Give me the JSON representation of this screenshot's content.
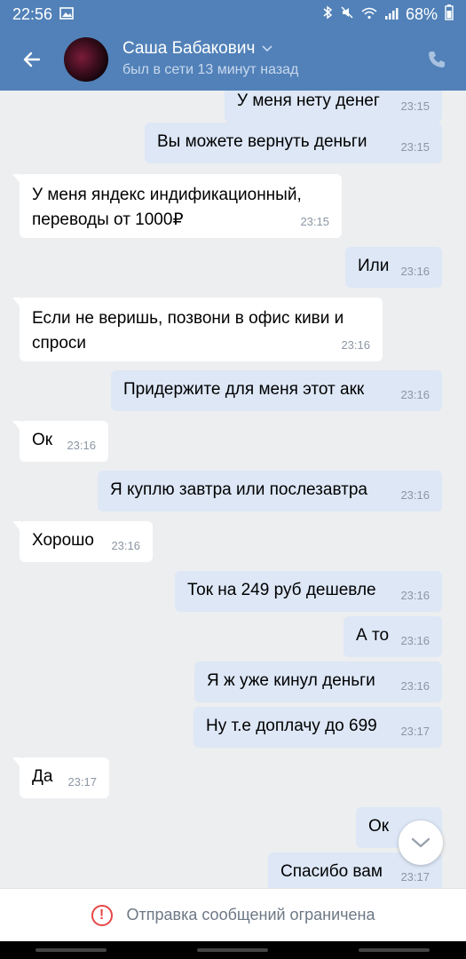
{
  "status_bar": {
    "time": "22:56",
    "icons": [
      "image-icon",
      "bluetooth-icon",
      "mute-icon",
      "wifi-icon",
      "signal-icon"
    ],
    "battery": "68%"
  },
  "header": {
    "contact_name": "Саша Бабакович",
    "status": "был в сети 13 минут назад"
  },
  "messages": [
    {
      "dir": "out",
      "text": "У меня нету денег",
      "time": "23:15"
    },
    {
      "dir": "out",
      "text": "Вы можете вернуть деньги",
      "time": "23:15"
    },
    {
      "dir": "in",
      "text": "У меня яндекс индификационный, переводы от 1000₽",
      "time": "23:15"
    },
    {
      "dir": "out",
      "text": "Или",
      "time": "23:16"
    },
    {
      "dir": "in",
      "text": "Если не веришь, позвони в офис киви и спроси",
      "time": "23:16"
    },
    {
      "dir": "out",
      "text": "Придержите для меня этот акк",
      "time": "23:16"
    },
    {
      "dir": "in",
      "text": "Ок",
      "time": "23:16"
    },
    {
      "dir": "out",
      "text": "Я куплю завтра или послезавтра",
      "time": "23:16"
    },
    {
      "dir": "in",
      "text": "Хорошо",
      "time": "23:16"
    },
    {
      "dir": "out",
      "text": "Ток на 249 руб дешевле",
      "time": "23:16"
    },
    {
      "dir": "out",
      "text": "А то",
      "time": "23:16"
    },
    {
      "dir": "out",
      "text": "Я ж уже кинул деньги",
      "time": "23:16"
    },
    {
      "dir": "out",
      "text": "Ну т.е доплачу до 699",
      "time": "23:17"
    },
    {
      "dir": "in",
      "text": "Да",
      "time": "23:17"
    },
    {
      "dir": "out",
      "text": "Ок",
      "time": ""
    },
    {
      "dir": "out",
      "text": "Спасибо вам",
      "time": "23:17"
    }
  ],
  "footer": {
    "restriction_text": "Отправка сообщений ограничена"
  },
  "colors": {
    "header": "#5181b8",
    "outgoing_bubble": "#dde7f6",
    "incoming_bubble": "#ffffff",
    "background": "#edeef0",
    "warning": "#e64646"
  }
}
